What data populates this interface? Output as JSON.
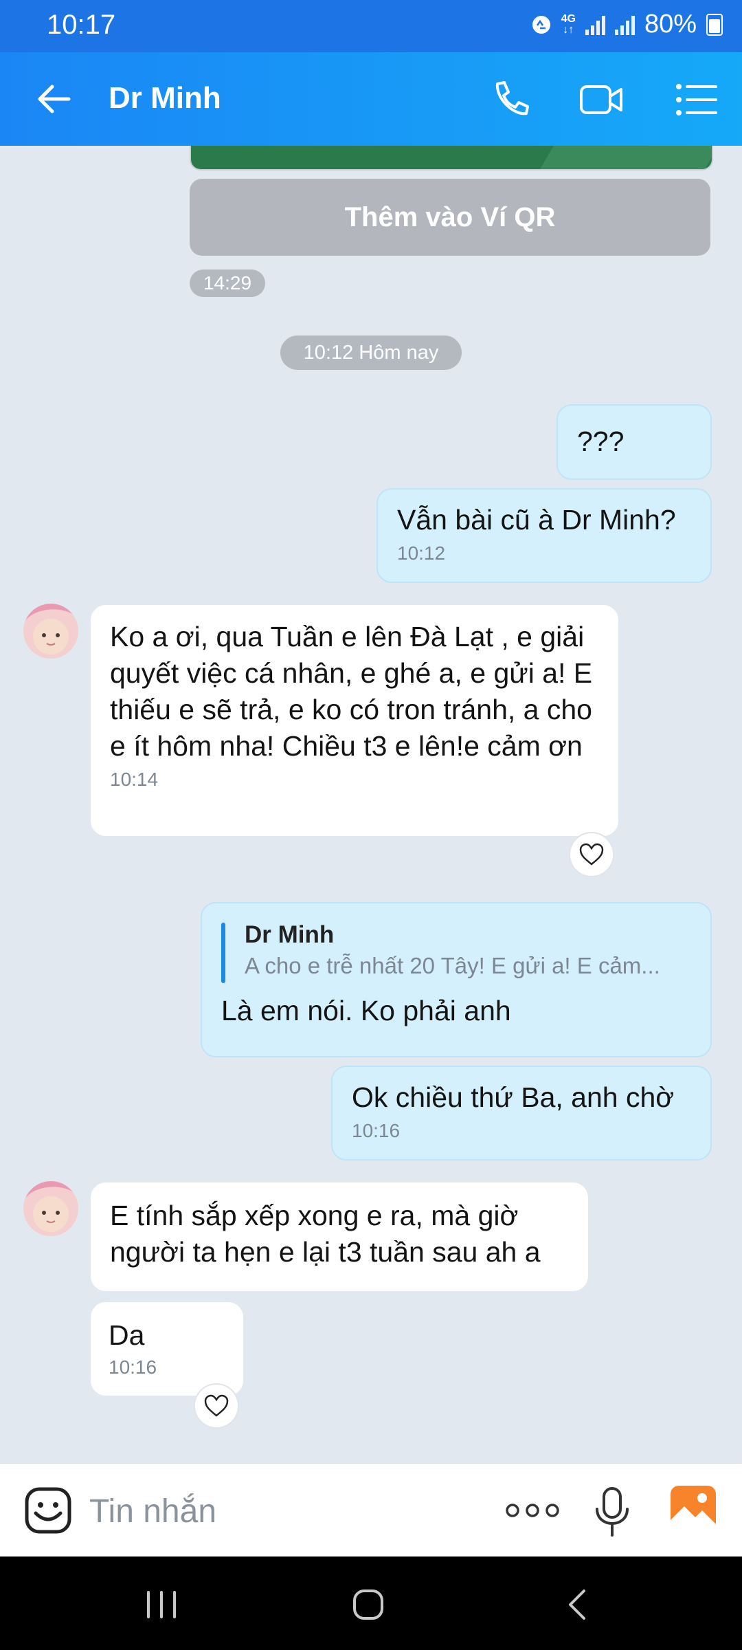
{
  "status_bar": {
    "time": "10:17",
    "network": "4G",
    "battery": "80%"
  },
  "header": {
    "title": "Dr Minh"
  },
  "messages": {
    "qr_button": "Thêm vào Ví QR",
    "qr_time": "14:29",
    "date_separator": "10:12 Hôm nay",
    "m1_text": "???",
    "m2_text": "Vẫn bài cũ à Dr Minh?",
    "m2_time": "10:12",
    "m3_text": "Ko a ơi, qua Tuần e lên Đà Lạt , e giải quyết việc cá nhân, e ghé a, e gửi a! E thiếu e sẽ trả, e ko có tron tránh, a cho e ít hôm nha! Chiều t3 e lên!e cảm ơn",
    "m3_time": "10:14",
    "m4_quote_author": "Dr Minh",
    "m4_quote_text": "A cho e trễ nhất 20 Tây! E gửi a! E cảm...",
    "m4_text": "Là em nói. Ko phải anh",
    "m5_text": "Ok chiều thứ Ba, anh chờ",
    "m5_time": "10:16",
    "m6_text": "E tính sắp xếp xong e ra, mà giờ người ta hẹn e lại t3 tuần sau ah a",
    "m7_text": "Da",
    "m7_time": "10:16"
  },
  "composer": {
    "placeholder": "Tin nhắn"
  },
  "colors": {
    "header_start": "#1a86f5",
    "header_end": "#16a9f8",
    "outgoing_bubble": "#d5f0fd",
    "incoming_bubble": "#ffffff",
    "quote_bar": "#1e88e5"
  }
}
